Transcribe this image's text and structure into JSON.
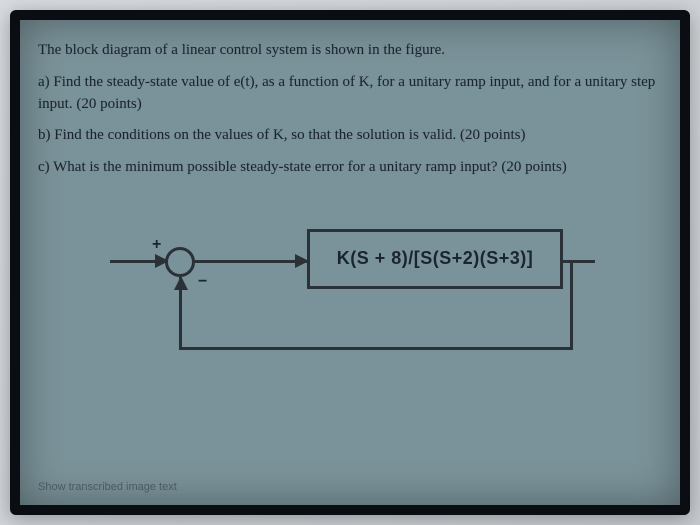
{
  "problem": {
    "intro": "The block diagram of a linear control system is shown in the figure.",
    "part_a": "a) Find the steady-state value of e(t), as a function of K, for a unitary ramp input, and for a unitary step input. (20 points)",
    "part_b": "b) Find the conditions on the values of K, so that the solution is valid. (20 points)",
    "part_c": "c) What is the minimum possible steady-state error for a unitary ramp input? (20 points)"
  },
  "diagram": {
    "transfer_function": "K(S + 8)/[S(S+2)(S+3)]",
    "sum_plus": "+",
    "sum_minus": "−"
  },
  "footer": {
    "link": "Show transcribed image text"
  }
}
